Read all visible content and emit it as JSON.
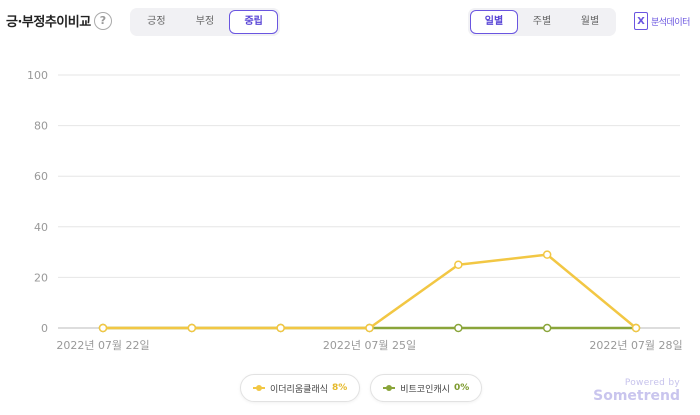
{
  "header": {
    "title": "긍·부정추이비교",
    "help_symbol": "?",
    "sentiment_tabs": [
      "긍정",
      "부정",
      "중립"
    ],
    "sentiment_active": 2,
    "period_tabs": [
      "일별",
      "주별",
      "월별"
    ],
    "period_active": 0,
    "download_label": "분석데이터",
    "download_icon": "X"
  },
  "colors": {
    "accent": "#6a55e0",
    "series1": "#f2c744",
    "series2": "#8aa53a"
  },
  "chart_data": {
    "type": "line",
    "x": [
      "2022-07-22",
      "2022-07-23",
      "2022-07-24",
      "2022-07-25",
      "2022-07-26",
      "2022-07-27",
      "2022-07-28"
    ],
    "x_tick_labels": [
      "2022년 07월 22일",
      "2022년 07월 25일",
      "2022년 07월 28일"
    ],
    "y_ticks": [
      "0",
      "20",
      "40",
      "60",
      "80",
      "100"
    ],
    "ylim": [
      0,
      100
    ],
    "grid": true,
    "series": [
      {
        "name": "이더리움클래식",
        "percent": "8%",
        "color": "#f2c744",
        "values": [
          0,
          0,
          0,
          0,
          25,
          29,
          0
        ]
      },
      {
        "name": "비트코인캐시",
        "percent": "0%",
        "color": "#8aa53a",
        "values": [
          0,
          0,
          0,
          0,
          0,
          0,
          0
        ]
      }
    ]
  },
  "brand": {
    "powered": "Powered by",
    "name": "Sometrend"
  }
}
